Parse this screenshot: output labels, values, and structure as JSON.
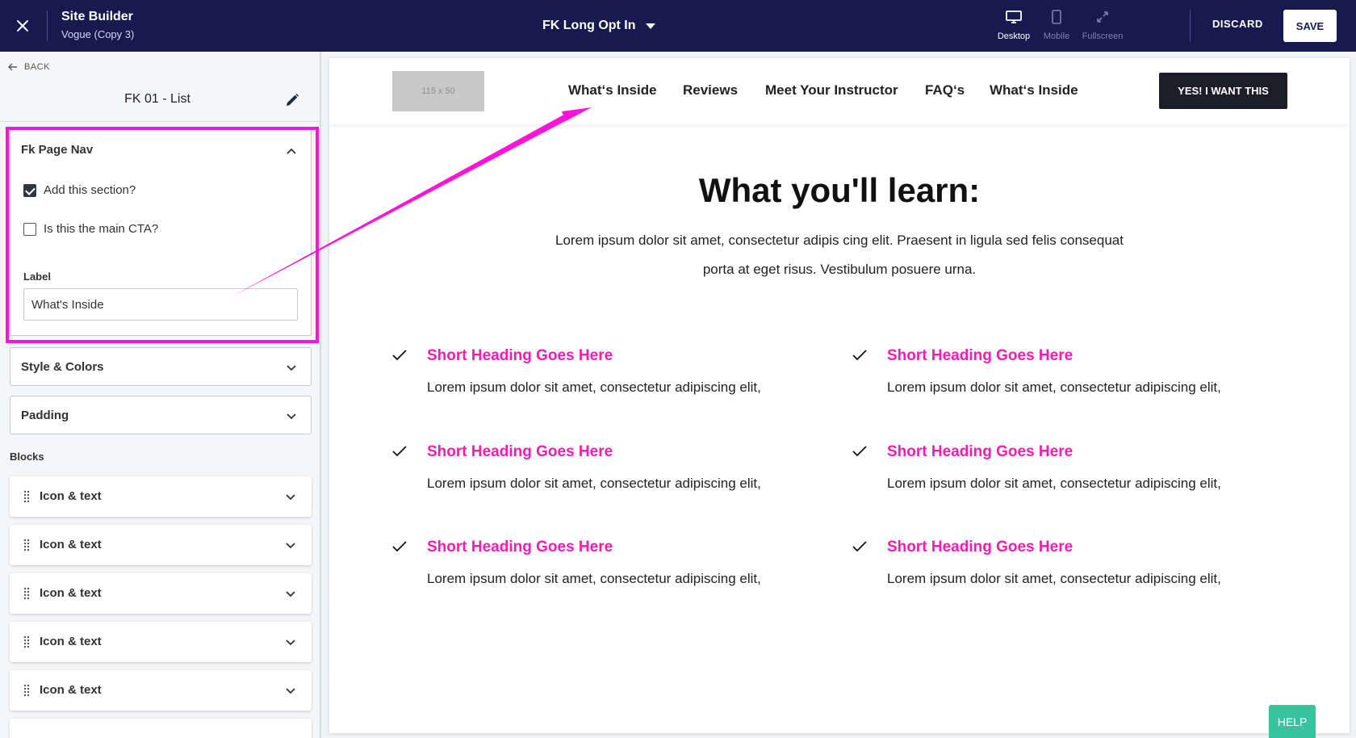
{
  "topbar": {
    "app_title": "Site Builder",
    "app_subtitle": "Vogue (Copy 3)",
    "page_name": "FK Long Opt In",
    "views": [
      {
        "label": "Desktop",
        "icon": "desktop-icon",
        "active": true
      },
      {
        "label": "Mobile",
        "icon": "mobile-icon",
        "active": false
      },
      {
        "label": "Fullscreen",
        "icon": "fullscreen-icon",
        "active": false
      }
    ],
    "discard_label": "DISCARD",
    "save_label": "SAVE",
    "bg_color": "#161a4f"
  },
  "sidebar": {
    "back_label": "BACK",
    "section_title": "FK 01 - List",
    "panel": {
      "title": "Fk Page Nav",
      "add_section_label": "Add this section?",
      "add_section_checked": true,
      "main_cta_label": "Is this the main CTA?",
      "main_cta_checked": false,
      "field_label": "Label",
      "field_value": "What's Inside"
    },
    "style_colors_label": "Style & Colors",
    "padding_label": "Padding",
    "blocks_label": "Blocks",
    "blocks": [
      {
        "label": "Icon & text"
      },
      {
        "label": "Icon & text"
      },
      {
        "label": "Icon & text"
      },
      {
        "label": "Icon & text"
      },
      {
        "label": "Icon & text"
      }
    ]
  },
  "preview": {
    "logo_placeholder": "115 x 50",
    "nav": [
      {
        "label": "What‘s Inside"
      },
      {
        "label": "Reviews"
      },
      {
        "label": "Meet Your Instructor"
      },
      {
        "label": "FAQ‘s"
      },
      {
        "label": "What‘s Inside"
      }
    ],
    "cta_label": "YES! I WANT THIS",
    "heading": "What you'll learn:",
    "intro_line1": "Lorem ipsum dolor sit amet, consectetur adipis cing elit. Praesent in ligula sed felis consequat",
    "intro_line2": "porta at eget risus. Vestibulum posuere urna.",
    "features": [
      {
        "heading": "Short Heading Goes Here",
        "body": "Lorem ipsum dolor sit amet, consectetur adipiscing elit,"
      },
      {
        "heading": "Short Heading Goes Here",
        "body": "Lorem ipsum dolor sit amet, consectetur adipiscing elit,"
      },
      {
        "heading": "Short Heading Goes Here",
        "body": "Lorem ipsum dolor sit amet, consectetur adipiscing elit,"
      },
      {
        "heading": "Short Heading Goes Here",
        "body": "Lorem ipsum dolor sit amet, consectetur adipiscing elit,"
      },
      {
        "heading": "Short Heading Goes Here",
        "body": "Lorem ipsum dolor sit amet, consectetur adipiscing elit,"
      },
      {
        "heading": "Short Heading Goes Here",
        "body": "Lorem ipsum dolor sit amet, consectetur adipiscing elit,"
      }
    ],
    "accent_color": "#ff18b4"
  },
  "help_label": "HELP",
  "annotation_color": "#ff14d8"
}
